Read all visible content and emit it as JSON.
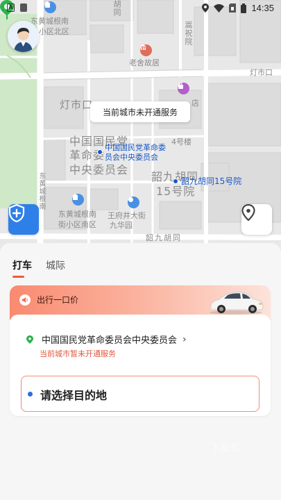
{
  "status_bar": {
    "time": "14:35",
    "left_icons": [
      "notification-a-icon",
      "notification-b-icon"
    ],
    "right_icons": [
      "location-icon",
      "wifi-icon",
      "sim-icon",
      "battery-icon"
    ]
  },
  "map": {
    "labels": {
      "block_top_left": "东黄城根南",
      "block_top_left_2": "小区北区",
      "road_top": "胡同",
      "road_vertical_right": "嵩祝院",
      "poi_laoshe": "老舍故居",
      "lamp_city": "灯市口",
      "road_right_top": "灯市口",
      "store_suffix": "店",
      "big_block_1": "中国国民党",
      "big_block_2": "革命委",
      "big_block_3": "中央委员会",
      "building_4": "4号楼",
      "shaojiu_1": "韶九胡同",
      "shaojiu_2": "15号院",
      "block_bottom_left": "东黄城根南",
      "block_bottom_left_2": "街小区南区",
      "road_shaojiu": "韶九胡同",
      "road_left_v": "东黄城根南",
      "shijia_1": "王府井大街",
      "shijia_2": "九华园"
    },
    "poi_main": {
      "line1": "中国国民党革命委",
      "line2": "员会中央委员会"
    },
    "poi_secondary": "韶九胡同15号院",
    "tooltip": "当前城市未开通服务"
  },
  "sheet": {
    "tabs": [
      {
        "label": "打车",
        "active": true
      },
      {
        "label": "城际",
        "active": false
      }
    ],
    "banner": {
      "text": "出行一口价"
    },
    "start": {
      "address": "中国国民党革命委员会中央委员会",
      "notice": "当前城市暂未开通服务"
    },
    "destination": {
      "placeholder": "请选择目的地"
    },
    "watermark": "下载汇"
  },
  "colors": {
    "accent": "#ee5a3a",
    "primary_blue": "#2f7fe8",
    "pin_green": "#2bb24c",
    "poi_blue": "#1a58c8"
  }
}
